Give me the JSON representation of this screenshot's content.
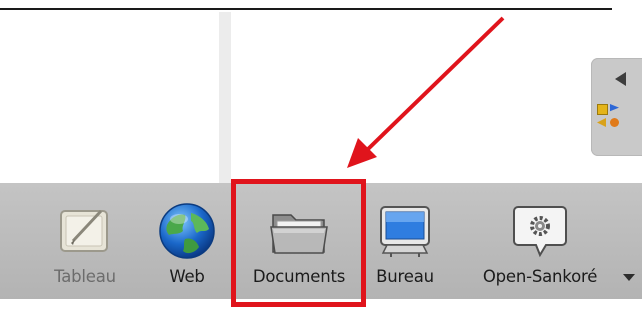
{
  "toolbar": {
    "items": [
      {
        "label": "Tableau",
        "icon": "whiteboard-pen-icon",
        "dimmed": true
      },
      {
        "label": "Web",
        "icon": "globe-icon",
        "dimmed": false
      },
      {
        "label": "Documents",
        "icon": "folder-icon",
        "dimmed": false,
        "highlighted": true
      },
      {
        "label": "Bureau",
        "icon": "monitor-icon",
        "dimmed": false
      },
      {
        "label": "Open-Sankoré",
        "icon": "settings-gear-bubble-icon",
        "dimmed": false
      }
    ],
    "more_icon": "chevron-down-icon"
  },
  "annotation": {
    "highlight_color": "#e0141c",
    "arrow_color": "#e0141c",
    "target": "Documents"
  },
  "colors": {
    "toolbar_bg": "#bdbdbd",
    "palette_bg": "#c9c9c9"
  }
}
